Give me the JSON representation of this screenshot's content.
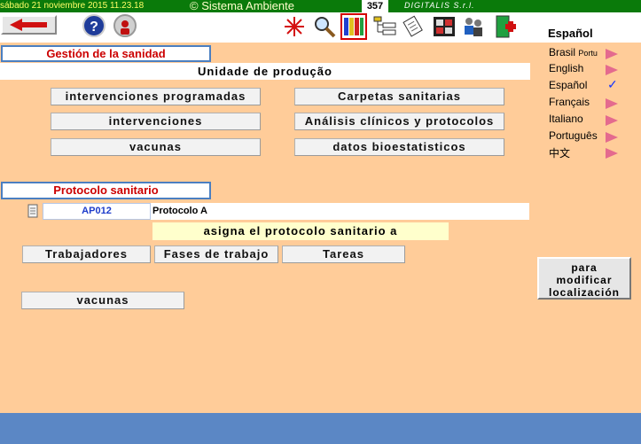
{
  "topbar": {
    "datetime": "sábado 21 noviembre 2015  11.23.18",
    "system_name": "© Sistema Ambiente",
    "counter": "357",
    "company": "DIGITALIS S.r.l."
  },
  "toolbar": {
    "help_label": "?",
    "icons": [
      "back-arrow-icon",
      "help-icon",
      "person-icon",
      "snowflake-icon",
      "magnifier-icon",
      "books-icon",
      "tree-list-icon",
      "documents-icon",
      "film-strip-icon",
      "people-icon",
      "exit-door-icon"
    ]
  },
  "language": {
    "current": "Español",
    "items": [
      {
        "label": "Brasil",
        "sub": "Portu"
      },
      {
        "label": "English",
        "sub": ""
      },
      {
        "label": "Español",
        "sub": ""
      },
      {
        "label": "Français",
        "sub": ""
      },
      {
        "label": "Italiano",
        "sub": ""
      },
      {
        "label": "Português",
        "sub": ""
      },
      {
        "label": "中文",
        "sub": ""
      }
    ]
  },
  "main": {
    "section_title": "Gestión de la sanidad",
    "unit": "Unidade de produção",
    "buttons": {
      "scheduled": "intervenciones programadas",
      "folders": "Carpetas sanitarias",
      "interventions": "intervenciones",
      "analyses": "Análisis clínicos y protocolos",
      "vaccines": "vacunas",
      "biostat": "datos bioestatisticos"
    }
  },
  "protocol": {
    "section_title": "Protocolo sanitario",
    "code": "AP012",
    "name": "Protocolo A",
    "assign": "asigna el protocolo sanitario a",
    "buttons": {
      "workers": "Trabajadores",
      "phases": "Fases de trabajo",
      "tasks": "Tareas",
      "vaccines": "vacunas"
    }
  },
  "side": {
    "modify_line1": "para",
    "modify_line2": "modificar",
    "modify_line3": "localización"
  },
  "colors": {
    "background": "#ffcc99",
    "topbar": "#0a7a0a",
    "footer": "#5b87c5",
    "section_text": "#cc0000"
  }
}
